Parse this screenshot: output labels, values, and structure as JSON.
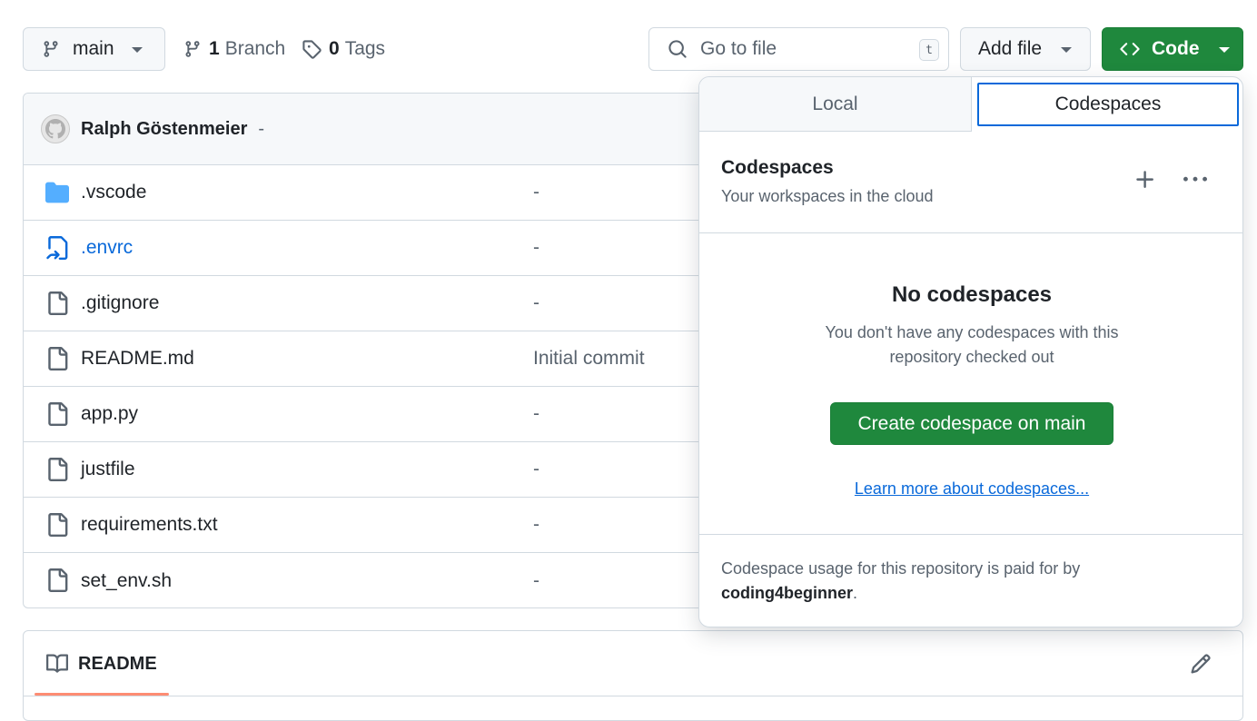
{
  "toolbar": {
    "branch": "main",
    "branches_count": "1",
    "branches_label": "Branch",
    "tags_count": "0",
    "tags_label": "Tags",
    "search_placeholder": "Go to file",
    "search_shortcut": "t",
    "add_file": "Add file",
    "code": "Code"
  },
  "commit": {
    "author": "Ralph Göstenmeier",
    "separator": "-"
  },
  "files": [
    {
      "name": ".vscode",
      "message": "-",
      "type": "folder"
    },
    {
      "name": ".envrc",
      "message": "-",
      "type": "symlink"
    },
    {
      "name": ".gitignore",
      "message": "-",
      "type": "file"
    },
    {
      "name": "README.md",
      "message": "Initial commit",
      "type": "file"
    },
    {
      "name": "app.py",
      "message": "-",
      "type": "file"
    },
    {
      "name": "justfile",
      "message": "-",
      "type": "file"
    },
    {
      "name": "requirements.txt",
      "message": "-",
      "type": "file"
    },
    {
      "name": "set_env.sh",
      "message": "-",
      "type": "file"
    }
  ],
  "readme": {
    "tab_label": "README"
  },
  "popover": {
    "tabs": [
      "Local",
      "Codespaces"
    ],
    "active_tab": "Codespaces",
    "title": "Codespaces",
    "subtitle": "Your workspaces in the cloud",
    "empty_title": "No codespaces",
    "empty_text": "You don't have any codespaces with this repository checked out",
    "create_button": "Create codespace on main",
    "learn_more": "Learn more about codespaces...",
    "footer_text": "Codespace usage for this repository is paid for by",
    "footer_owner": "coding4beginner",
    "footer_period": "."
  },
  "colors": {
    "primary": "#1f883d",
    "accent": "#0969da",
    "folder": "#54aeff"
  }
}
